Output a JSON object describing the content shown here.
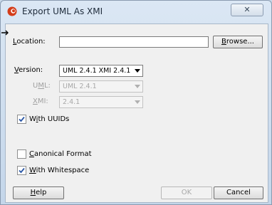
{
  "window": {
    "title": "Export UML As XMI",
    "close_glyph": "✕"
  },
  "location": {
    "label_u": "L",
    "label_rest": "ocation:",
    "value": "",
    "browse_u": "B",
    "browse_rest": "rowse..."
  },
  "version": {
    "label_u": "V",
    "label_rest": "ersion:",
    "selected": "UML 2.4.1 XMI 2.4.1"
  },
  "uml": {
    "label_pre": "U",
    "label_u": "M",
    "label_rest": "L:",
    "selected": "UML 2.4.1"
  },
  "xmi": {
    "label_u": "X",
    "label_rest": "MI:",
    "selected": "2.4.1"
  },
  "options": {
    "uuids": {
      "label_pre": "W",
      "label_u": "i",
      "label_rest": "th UUIDs",
      "checked": true
    },
    "canonical": {
      "label_u": "C",
      "label_rest": "anonical Format",
      "checked": false
    },
    "whitespace": {
      "label_u": "W",
      "label_rest": "ith Whitespace",
      "checked": true
    }
  },
  "buttons": {
    "help_u": "H",
    "help_rest": "elp",
    "ok": "OK",
    "cancel": "Cancel"
  },
  "icons": {
    "app": "oracle-icon",
    "check": "check-icon"
  }
}
